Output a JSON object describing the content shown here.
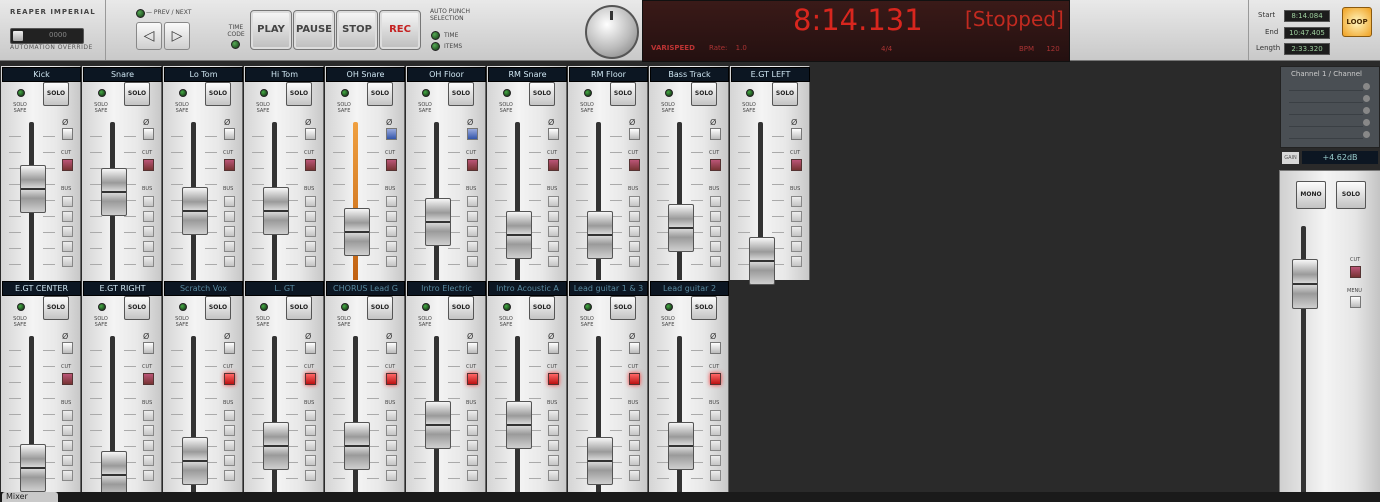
{
  "transport": {
    "brand": "REAPER IMPERIAL",
    "automation_override": "AUTOMATION OVERRIDE",
    "automation_mode": "0000",
    "prev_next_label": "— PREV / NEXT",
    "prev_glyph": "◁",
    "next_glyph": "▷",
    "time_code_label": "TIME CODE",
    "play": "PLAY",
    "pause": "PAUSE",
    "stop": "STOP",
    "rec": "REC",
    "auto_punch_label": "AUTO PUNCH SELECTION",
    "punch_time": "TIME",
    "punch_items": "ITEMS"
  },
  "display": {
    "time": "8:14.131",
    "state": "[Stopped]",
    "varispeed": "VARISPEED",
    "rate_label": "Rate:",
    "rate_value": "1.0",
    "signature": "4/4",
    "bpm_label": "BPM",
    "bpm_value": "120"
  },
  "loop_region": {
    "start_label": "Start",
    "start_value": "8:14.084",
    "end_label": "End",
    "end_value": "10:47.405",
    "length_label": "Length",
    "length_value": "2:33.320",
    "loop_button": "LOOP"
  },
  "strip_labels": {
    "solo": "SOLO",
    "solo_safe": "SOLO SAFE",
    "phase": "Ø",
    "cut": "CUT",
    "bus": "BUS"
  },
  "rows": [
    {
      "strips": [
        {
          "name": "Kick",
          "cut_on": false,
          "phase_on": false,
          "fader": 0.7
        },
        {
          "name": "Snare",
          "cut_on": false,
          "phase_on": false,
          "fader": 0.68
        },
        {
          "name": "Lo Tom",
          "cut_on": false,
          "phase_on": false,
          "fader": 0.55
        },
        {
          "name": "Hi Tom",
          "cut_on": false,
          "phase_on": false,
          "fader": 0.55
        },
        {
          "name": "OH Snare",
          "cut_on": false,
          "phase_on": true,
          "fader": 0.4,
          "lit": true
        },
        {
          "name": "OH Floor",
          "cut_on": false,
          "phase_on": true,
          "fader": 0.47
        },
        {
          "name": "RM Snare",
          "cut_on": false,
          "phase_on": false,
          "fader": 0.38
        },
        {
          "name": "RM Floor",
          "cut_on": false,
          "phase_on": false,
          "fader": 0.38
        },
        {
          "name": "Bass Track",
          "cut_on": false,
          "phase_on": false,
          "fader": 0.43
        },
        {
          "name": "E.GT LEFT",
          "cut_on": false,
          "phase_on": false,
          "fader": 0.2
        }
      ]
    },
    {
      "strips": [
        {
          "name": "E.GT CENTER",
          "cut_on": false,
          "phase_on": false,
          "fader": 0.25
        },
        {
          "name": "E.GT RIGHT",
          "cut_on": false,
          "phase_on": false,
          "fader": 0.2
        },
        {
          "name": "Scratch Vox",
          "cut_on": true,
          "phase_on": false,
          "fader": 0.3,
          "dim": true
        },
        {
          "name": "L. GT",
          "cut_on": true,
          "phase_on": false,
          "fader": 0.4,
          "dim": true
        },
        {
          "name": "CHORUS Lead G",
          "cut_on": true,
          "phase_on": false,
          "fader": 0.4,
          "dim": true
        },
        {
          "name": "Intro Electric",
          "cut_on": true,
          "phase_on": false,
          "fader": 0.55,
          "dim": true
        },
        {
          "name": "Intro Acoustic A",
          "cut_on": true,
          "phase_on": false,
          "fader": 0.55,
          "dim": true
        },
        {
          "name": "Lead guitar 1 & 3",
          "cut_on": true,
          "phase_on": false,
          "fader": 0.3,
          "dim": true
        },
        {
          "name": "Lead guitar 2",
          "cut_on": true,
          "phase_on": false,
          "fader": 0.4,
          "dim": true
        }
      ]
    }
  ],
  "master": {
    "channel_title": "Channel 1 / Channel",
    "gain_label": "GAIN",
    "gain_value": "+4.62dB",
    "mono": "MONO",
    "solo": "SOLO",
    "cut": "CUT",
    "menu": "MENU"
  },
  "bottom": {
    "tab": "Mixer"
  }
}
